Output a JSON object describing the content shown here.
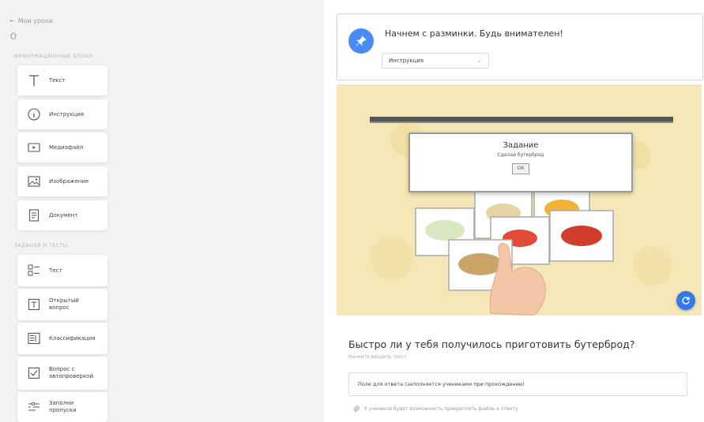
{
  "sidebar": {
    "back_label": "Мои уроки",
    "section_info": "информационные блоки",
    "section_tasks": "задания и тесты",
    "info_blocks": [
      {
        "label": "Текст",
        "icon": "text-icon"
      },
      {
        "label": "Инструкция",
        "icon": "info-icon"
      },
      {
        "label": "Медиафайл",
        "icon": "media-file-icon"
      },
      {
        "label": "Изображение",
        "icon": "image-icon"
      },
      {
        "label": "Документ",
        "icon": "document-icon"
      }
    ],
    "task_blocks": [
      {
        "label": "Тест",
        "icon": "test-icon"
      },
      {
        "label": "Открытый вопрос",
        "icon": "open-question-icon"
      },
      {
        "label": "Классификация",
        "icon": "classification-icon"
      },
      {
        "label": "Вопрос с автопроверкой",
        "icon": "autocheck-icon"
      },
      {
        "label": "Заполни пропуски",
        "icon": "fill-gaps-icon"
      }
    ]
  },
  "instruction_card": {
    "title": "Начнем с разминки. Будь внимателен!",
    "type_select": "Инструкция"
  },
  "media": {
    "dialog_title": "Задание",
    "dialog_subtitle": "Сделай бутерброд",
    "dialog_ok": "ОК"
  },
  "question": {
    "text": "Быстро ли у тебя получилось приготовить бутерброд?",
    "hint": "Начните вводить текст",
    "answer_placeholder": "Поле для ответа (заполняется учениками при прохождении)",
    "attach_note": "У учеников будет возможность прикреплять файлы к ответу"
  },
  "colors": {
    "accent": "#4a8af4",
    "media_bg": "#f6e8b6"
  }
}
